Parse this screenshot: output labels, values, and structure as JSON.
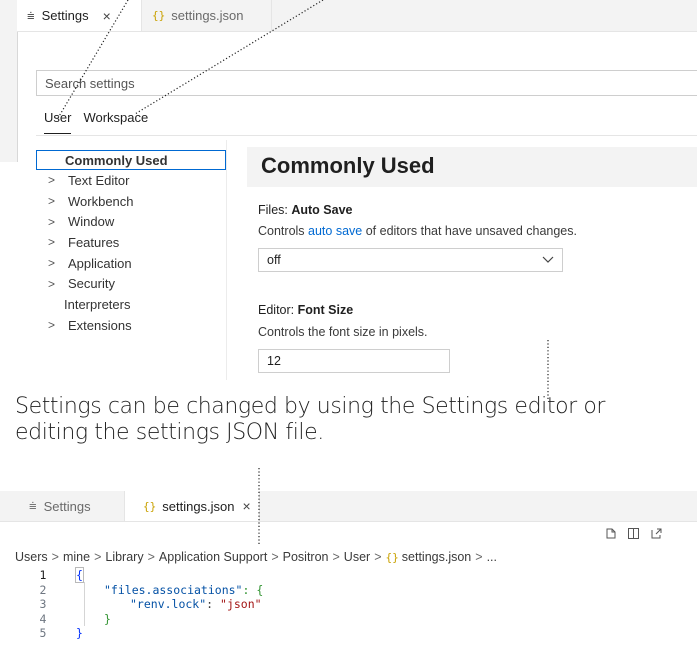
{
  "top": {
    "tabs": [
      {
        "label": "Settings",
        "icon": "settings-sliders-icon",
        "close": "×"
      },
      {
        "label": "settings.json",
        "icon": "json-braces-icon",
        "icon_text": "{}"
      }
    ],
    "search": {
      "placeholder": "Search settings"
    },
    "scope_tabs": [
      "User",
      "Workspace"
    ],
    "toc": [
      {
        "label": "Commonly Used",
        "selected": true,
        "expandable": false
      },
      {
        "label": "Text Editor",
        "expandable": true
      },
      {
        "label": "Workbench",
        "expandable": true
      },
      {
        "label": "Window",
        "expandable": true
      },
      {
        "label": "Features",
        "expandable": true
      },
      {
        "label": "Application",
        "expandable": true
      },
      {
        "label": "Security",
        "expandable": true
      },
      {
        "label": "Interpreters",
        "expandable": false
      },
      {
        "label": "Extensions",
        "expandable": true
      }
    ],
    "section_title": "Commonly Used",
    "settings": [
      {
        "category": "Files: ",
        "name": "Auto Save",
        "desc_before": "Controls ",
        "desc_link": "auto save",
        "desc_after": " of editors that have unsaved changes.",
        "value": "off"
      },
      {
        "category": "Editor: ",
        "name": "Font Size",
        "desc": "Controls the font size in pixels.",
        "value": "12"
      }
    ]
  },
  "caption": "Settings can be changed by using the Settings editor or editing the settings JSON file.",
  "bottom": {
    "tabs": [
      {
        "label": "Settings",
        "icon": "settings-sliders-icon"
      },
      {
        "label": "settings.json",
        "icon": "json-braces-icon",
        "icon_text": "{}",
        "close": "×"
      }
    ],
    "breadcrumb": [
      "Users",
      "mine",
      "Library",
      "Application Support",
      "Positron",
      "User",
      "settings.json",
      "..."
    ],
    "code_lines": [
      {
        "n": "1",
        "text": "{"
      },
      {
        "n": "2",
        "key": "\"files.associations\"",
        "after": ": {"
      },
      {
        "n": "3",
        "key": "\"renv.lock\"",
        "mid": ": ",
        "str": "\"json\""
      },
      {
        "n": "4",
        "text": "}"
      },
      {
        "n": "5",
        "text": "}"
      }
    ]
  },
  "colors": {
    "link": "#0069d2",
    "json_icon": "#c9a100",
    "selection_border": "#0069d2"
  }
}
